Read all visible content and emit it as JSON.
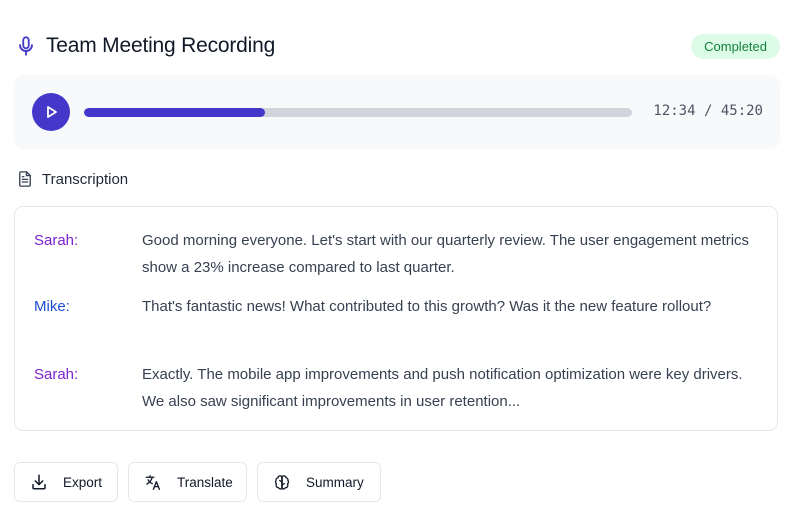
{
  "header": {
    "title": "Team Meeting Recording",
    "status": "Completed",
    "icon": "microphone-icon"
  },
  "player": {
    "current_time": "12:34",
    "total_time": "45:20",
    "time_separator": " / ",
    "progress_fraction": 0.33,
    "accent_color": "#4338ca"
  },
  "transcription": {
    "heading": "Transcription",
    "entries": [
      {
        "speaker": "Sarah:",
        "text": "Good morning everyone. Let's start with our quarterly review. The user engagement metrics show a 23% increase compared to last quarter."
      },
      {
        "speaker": "Mike:",
        "text": "That's fantastic news! What contributed to this growth? Was it the new feature rollout?"
      },
      {
        "speaker": "Sarah:",
        "text": "Exactly. The mobile app improvements and push notification optimization were key drivers. We also saw significant improvements in user retention..."
      }
    ]
  },
  "actions": {
    "export_label": "Export",
    "translate_label": "Translate",
    "summary_label": "Summary"
  },
  "colors": {
    "speaker_sarah": "#7e22ce",
    "speaker_mike": "#1d4ed8",
    "status_bg": "#dcfce7",
    "status_text": "#15803d"
  }
}
